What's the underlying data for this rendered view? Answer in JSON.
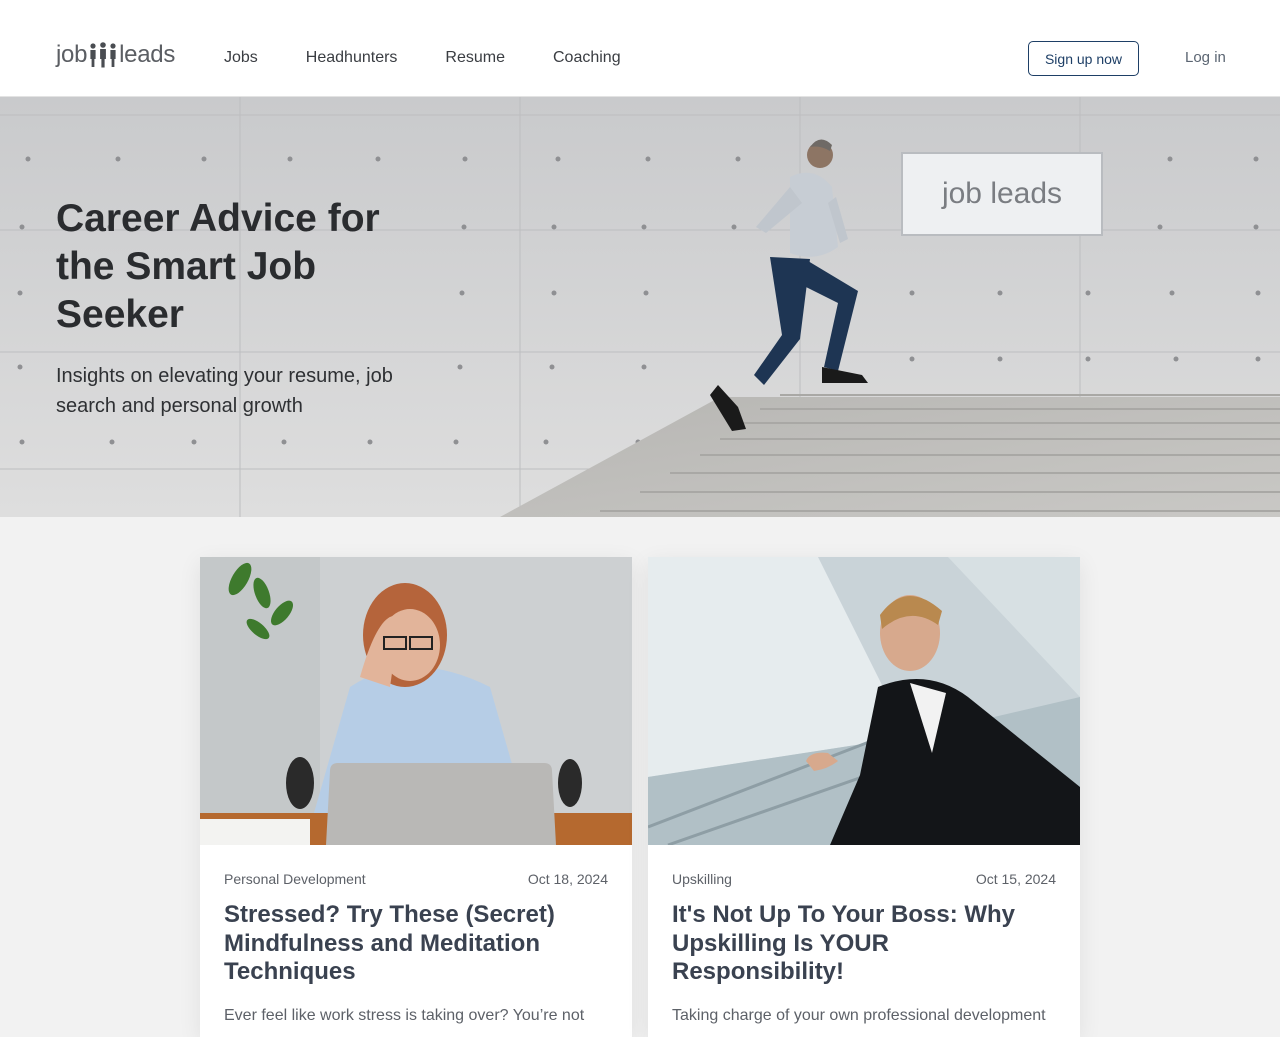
{
  "brand": {
    "logo_left": "job",
    "logo_right": "leads",
    "sign_text": "job leads"
  },
  "nav": [
    {
      "label": "Jobs"
    },
    {
      "label": "Headhunters"
    },
    {
      "label": "Resume"
    },
    {
      "label": "Coaching"
    }
  ],
  "auth": {
    "signup_label": "Sign up now",
    "login_label": "Log in"
  },
  "hero": {
    "title": "Career Advice for the Smart Job Seeker",
    "subtitle": "Insights on elevating your resume, job search and personal growth"
  },
  "articles": [
    {
      "category": "Personal Development",
      "date": "Oct 18, 2024",
      "title": "Stressed? Try These (Secret) Mindfulness and Meditation Techniques",
      "excerpt": "Ever feel like work stress is taking over? You’re not"
    },
    {
      "category": "Upskilling",
      "date": "Oct 15, 2024",
      "title": "It's Not Up To Your Boss: Why Upskilling Is YOUR Responsibility!",
      "excerpt": "Taking charge of your own professional development"
    }
  ],
  "colors": {
    "accent": "#1e3f66",
    "title": "#3a4250",
    "meta": "#5d6168"
  }
}
